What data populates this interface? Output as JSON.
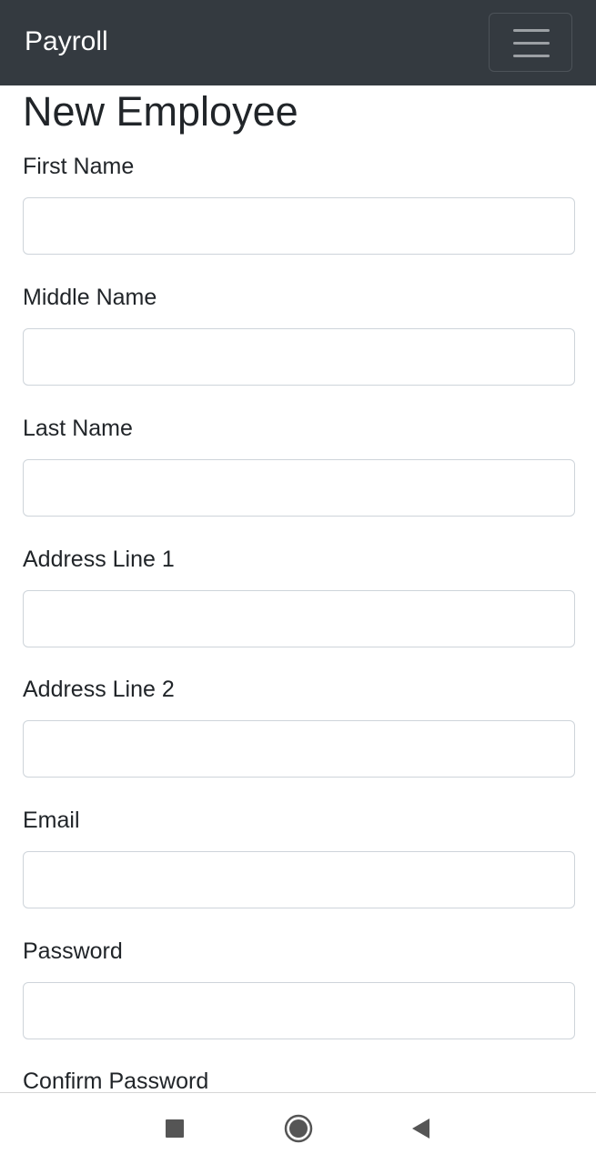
{
  "navbar": {
    "brand": "Payroll",
    "toggler_icon": "hamburger-menu-icon"
  },
  "page": {
    "title": "New Employee"
  },
  "form": {
    "fields": [
      {
        "label": "First Name",
        "value": "",
        "type": "text"
      },
      {
        "label": "Middle Name",
        "value": "",
        "type": "text"
      },
      {
        "label": "Last Name",
        "value": "",
        "type": "text"
      },
      {
        "label": "Address Line 1",
        "value": "",
        "type": "text"
      },
      {
        "label": "Address Line 2",
        "value": "",
        "type": "text"
      },
      {
        "label": "Email",
        "value": "",
        "type": "email"
      },
      {
        "label": "Password",
        "value": "",
        "type": "password"
      },
      {
        "label": "Confirm Password",
        "value": "",
        "type": "password"
      }
    ]
  },
  "system_nav": {
    "buttons": [
      {
        "icon": "square-stop-icon"
      },
      {
        "icon": "circle-home-icon"
      },
      {
        "icon": "triangle-back-icon"
      }
    ]
  },
  "colors": {
    "navbar_bg": "#343a40",
    "text": "#212529",
    "input_border": "#ced4da"
  }
}
